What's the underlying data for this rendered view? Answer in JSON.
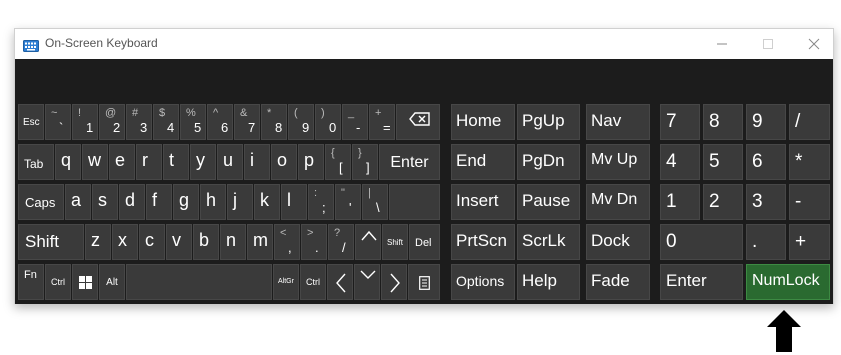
{
  "window": {
    "title": "On-Screen Keyboard"
  },
  "keys": {
    "esc": "Esc",
    "digits": [
      {
        "s": "~",
        "b": "`"
      },
      {
        "s": "!",
        "b": "1"
      },
      {
        "s": "@",
        "b": "2"
      },
      {
        "s": "#",
        "b": "3"
      },
      {
        "s": "$",
        "b": "4"
      },
      {
        "s": "%",
        "b": "5"
      },
      {
        "s": "^",
        "b": "6"
      },
      {
        "s": "&",
        "b": "7"
      },
      {
        "s": "*",
        "b": "8"
      },
      {
        "s": "(",
        "b": "9"
      },
      {
        "s": ")",
        "b": "0"
      },
      {
        "s": "_",
        "b": "-"
      },
      {
        "s": "+",
        "b": "="
      }
    ],
    "tab": "Tab",
    "row_q": [
      "q",
      "w",
      "e",
      "r",
      "t",
      "y",
      "u",
      "i",
      "o",
      "p"
    ],
    "lbracket": {
      "s": "{",
      "b": "["
    },
    "rbracket": {
      "s": "}",
      "b": "]"
    },
    "enter": "Enter",
    "caps": "Caps",
    "row_a": [
      "a",
      "s",
      "d",
      "f",
      "g",
      "h",
      "j",
      "k",
      "l"
    ],
    "semicolon": {
      "s": ":",
      "b": ";"
    },
    "quote": {
      "s": "\"",
      "b": "'"
    },
    "backslash": {
      "s": "|",
      "b": "\\"
    },
    "shift": "Shift",
    "row_z": [
      "z",
      "x",
      "c",
      "v",
      "b",
      "n",
      "m"
    ],
    "comma": {
      "s": "<",
      "b": ","
    },
    "period": {
      "s": ">",
      "b": "."
    },
    "slash": {
      "s": "?",
      "b": "/"
    },
    "shift_small": "Shift",
    "del": "Del",
    "fn": "Fn",
    "ctrl": "Ctrl",
    "alt": "Alt",
    "alt_gr": "AltGr",
    "ctrl_right": "Ctrl",
    "nav": {
      "home": "Home",
      "pgup": "PgUp",
      "nav": "Nav",
      "end": "End",
      "pgdn": "PgDn",
      "mvup": "Mv Up",
      "insert": "Insert",
      "pause": "Pause",
      "mvdn": "Mv Dn",
      "prtscn": "PrtScn",
      "scrlk": "ScrLk",
      "dock": "Dock",
      "options": "Options",
      "help": "Help",
      "fade": "Fade"
    },
    "numpad": {
      "n7": "7",
      "n8": "8",
      "n9": "9",
      "div": "/",
      "n4": "4",
      "n5": "5",
      "n6": "6",
      "mul": "*",
      "n1": "1",
      "n2": "2",
      "n3": "3",
      "sub": "-",
      "n0": "0",
      "dot": ".",
      "add": "+",
      "enter": "Enter",
      "numlock": "NumLock"
    }
  },
  "colors": {
    "keyboard_bg": "#1c1c1c",
    "key_bg": "#3a3a3a",
    "numlock_active": "#2a6a30"
  }
}
